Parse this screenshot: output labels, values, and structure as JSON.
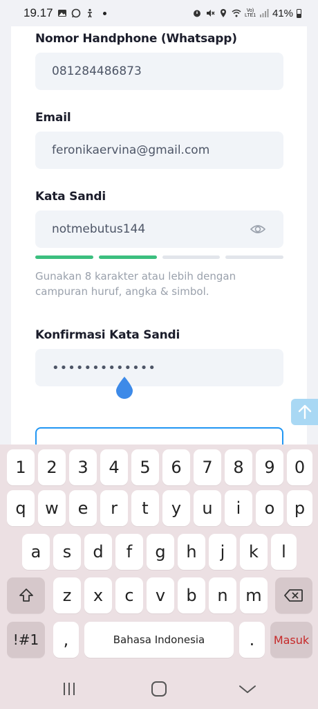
{
  "status_bar": {
    "time": "19.17",
    "battery": "41%",
    "network": "Vo) LTE1"
  },
  "form": {
    "phone_label": "Nomor Handphone (Whatsapp)",
    "phone_value": "081284486873",
    "email_label": "Email",
    "email_value": "feronikaervina@gmail.com",
    "password_label": "Kata Sandi",
    "password_value": "notmebutus144",
    "password_strength": 0.5,
    "password_hint": "Gunakan 8 karakter atau lebih dengan campuran huruf, angka & simbol.",
    "confirm_label": "Konfirmasi Kata Sandi",
    "confirm_value": "•••••••••••••"
  },
  "keyboard": {
    "row_numbers": [
      "1",
      "2",
      "3",
      "4",
      "5",
      "6",
      "7",
      "8",
      "9",
      "0"
    ],
    "row1": [
      "q",
      "w",
      "e",
      "r",
      "t",
      "y",
      "u",
      "i",
      "o",
      "p"
    ],
    "row2": [
      "a",
      "s",
      "d",
      "f",
      "g",
      "h",
      "j",
      "k",
      "l"
    ],
    "row3": [
      "z",
      "x",
      "c",
      "v",
      "b",
      "n",
      "m"
    ],
    "symbols_label": "!#1",
    "comma_label": ",",
    "space_label": "Bahasa Indonesia",
    "period_label": ".",
    "enter_label": "Masuk"
  }
}
